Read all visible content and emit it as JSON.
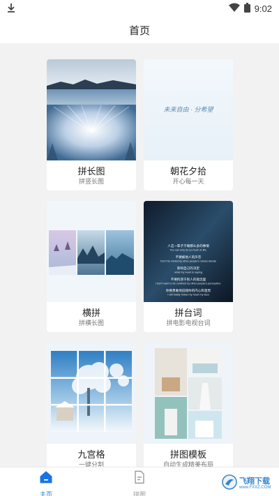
{
  "status_bar": {
    "time": "9:02",
    "icons": [
      "download-icon",
      "wifi-icon",
      "battery-icon"
    ]
  },
  "header": {
    "title": "首页"
  },
  "cards": [
    {
      "title": "拼长图",
      "subtitle": "拼竖长图"
    },
    {
      "title": "朝花夕拾",
      "subtitle": "开心每一天",
      "thumb_text": "未来自由 · 分希望"
    },
    {
      "title": "横拼",
      "subtitle": "拼横长图"
    },
    {
      "title": "拼台词",
      "subtitle": "拼电影电视台词",
      "subtitles": [
        {
          "cn": "人这一辈子干嘛那么多的事情",
          "en": "You can only do so much in life."
        },
        {
          "cn": "不要被他人的声音",
          "en": "Don't be misled by other people's voices decide"
        },
        {
          "cn": "影响自己的决定",
          "en": "what my heart is saying"
        },
        {
          "cn": "不要拘泥于别人的观念里",
          "en": "I don't want to be confined by other people's perception."
        },
        {
          "cn": "你要勇敢地追随你的内心和直觉",
          "en": "I will totally follow my heart my idea"
        }
      ]
    },
    {
      "title": "九宫格",
      "subtitle": "一键分割"
    },
    {
      "title": "拼图模板",
      "subtitle": "自动生成精美布局"
    }
  ],
  "tabbar": {
    "tabs": [
      {
        "label": "主页",
        "active": true
      },
      {
        "label": "拼图",
        "active": false
      }
    ]
  },
  "watermark": {
    "text": "飞翔下载",
    "sub": "www.FXXZ.COM"
  },
  "colors": {
    "accent": "#1a73e8",
    "inactive": "#9a9a9a"
  }
}
